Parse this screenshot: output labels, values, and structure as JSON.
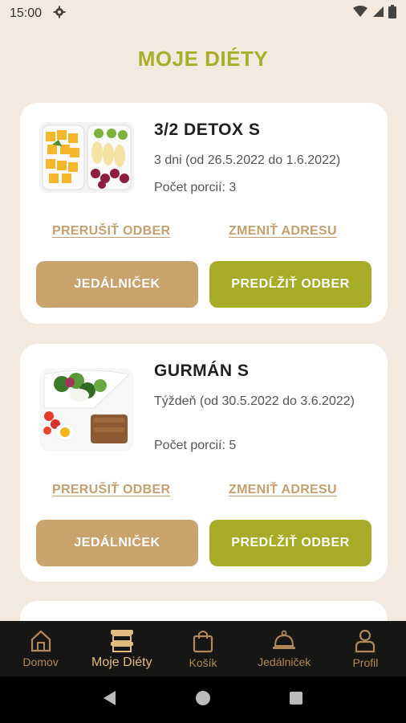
{
  "status_bar": {
    "time": "15:00"
  },
  "page_title": "MOJE DIÉTY",
  "diets": [
    {
      "name": "3/2 DETOX S",
      "period": "3 dni (od 26.5.2022 do 1.6.2022)",
      "portions": "Počet porcií: 3",
      "pause_label": "PRERUŠIŤ ODBER",
      "address_label": "ZMENIŤ ADRESU",
      "menu_label": "JEDÁLNIČEK",
      "extend_label": "PREDĹŽIŤ ODBER"
    },
    {
      "name": "GURMÁN S",
      "period": "Týždeň (od 30.5.2022 do 3.6.2022)",
      "portions": "Počet porcií: 5",
      "pause_label": "PRERUŠIŤ ODBER",
      "address_label": "ZMENIŤ ADRESU",
      "menu_label": "JEDÁLNIČEK",
      "extend_label": "PREDĹŽIŤ ODBER"
    }
  ],
  "bottom_nav": [
    {
      "label": "Domov",
      "icon": "home-icon"
    },
    {
      "label": "Moje Diéty",
      "icon": "food-containers-icon",
      "active": true
    },
    {
      "label": "Košík",
      "icon": "shopping-bag-icon"
    },
    {
      "label": "Jedálniček",
      "icon": "cloche-icon"
    },
    {
      "label": "Profil",
      "icon": "profile-icon"
    }
  ],
  "colors": {
    "background": "#f3e9de",
    "accent_green": "#a7ac28",
    "accent_tan": "#c9a26d",
    "nav_background": "#161615"
  }
}
